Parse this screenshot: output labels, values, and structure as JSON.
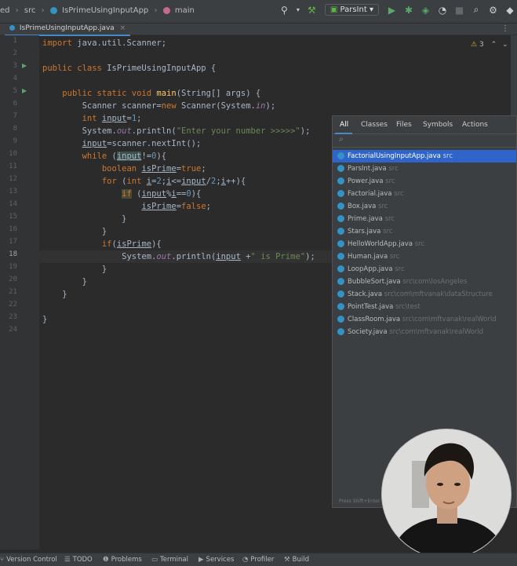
{
  "breadcrumb": {
    "project_partial": "ed",
    "folder": "src",
    "file": "IsPrimeUsingInputApp",
    "method": "main"
  },
  "toolbar": {
    "run_config": "ParsInt"
  },
  "editor": {
    "tab_label": "IsPrimeUsingInputApp.java",
    "inspection_count": "3",
    "line_numbers": [
      "1",
      "2",
      "3",
      "4",
      "5",
      "6",
      "7",
      "8",
      "9",
      "10",
      "11",
      "12",
      "13",
      "14",
      "15",
      "16",
      "17",
      "18",
      "19",
      "20",
      "21",
      "22",
      "23",
      "24"
    ]
  },
  "search_popup": {
    "tabs": [
      "All",
      "Classes",
      "Files",
      "Symbols",
      "Actions"
    ],
    "selected_tab": "All",
    "results": [
      {
        "name": "FactorialUsingInputApp.java",
        "path": "src"
      },
      {
        "name": "ParsInt.java",
        "path": "src"
      },
      {
        "name": "Power.java",
        "path": "src"
      },
      {
        "name": "Factorial.java",
        "path": "src"
      },
      {
        "name": "Box.java",
        "path": "src"
      },
      {
        "name": "Prime.java",
        "path": "src"
      },
      {
        "name": "Stars.java",
        "path": "src"
      },
      {
        "name": "HelloWorldApp.java",
        "path": "src"
      },
      {
        "name": "Human.java",
        "path": "src"
      },
      {
        "name": "LoopApp.java",
        "path": "src"
      },
      {
        "name": "BubbleSort.java",
        "path": "src\\com\\losAngeles"
      },
      {
        "name": "Stack.java",
        "path": "src\\com\\mftvanak\\dataStructure"
      },
      {
        "name": "PointTest.java",
        "path": "src\\test"
      },
      {
        "name": "ClassRoom.java",
        "path": "src\\com\\mftvanak\\realWorld"
      },
      {
        "name": "Society.java",
        "path": "src\\com\\mftvanak\\realWorld"
      }
    ],
    "hint": "Press Shift+Enter"
  },
  "bottom_bar": {
    "version_control": "Version Control",
    "todo": "TODO",
    "problems": "Problems",
    "terminal": "Terminal",
    "services": "Services",
    "profiler": "Profiler",
    "build": "Build"
  }
}
